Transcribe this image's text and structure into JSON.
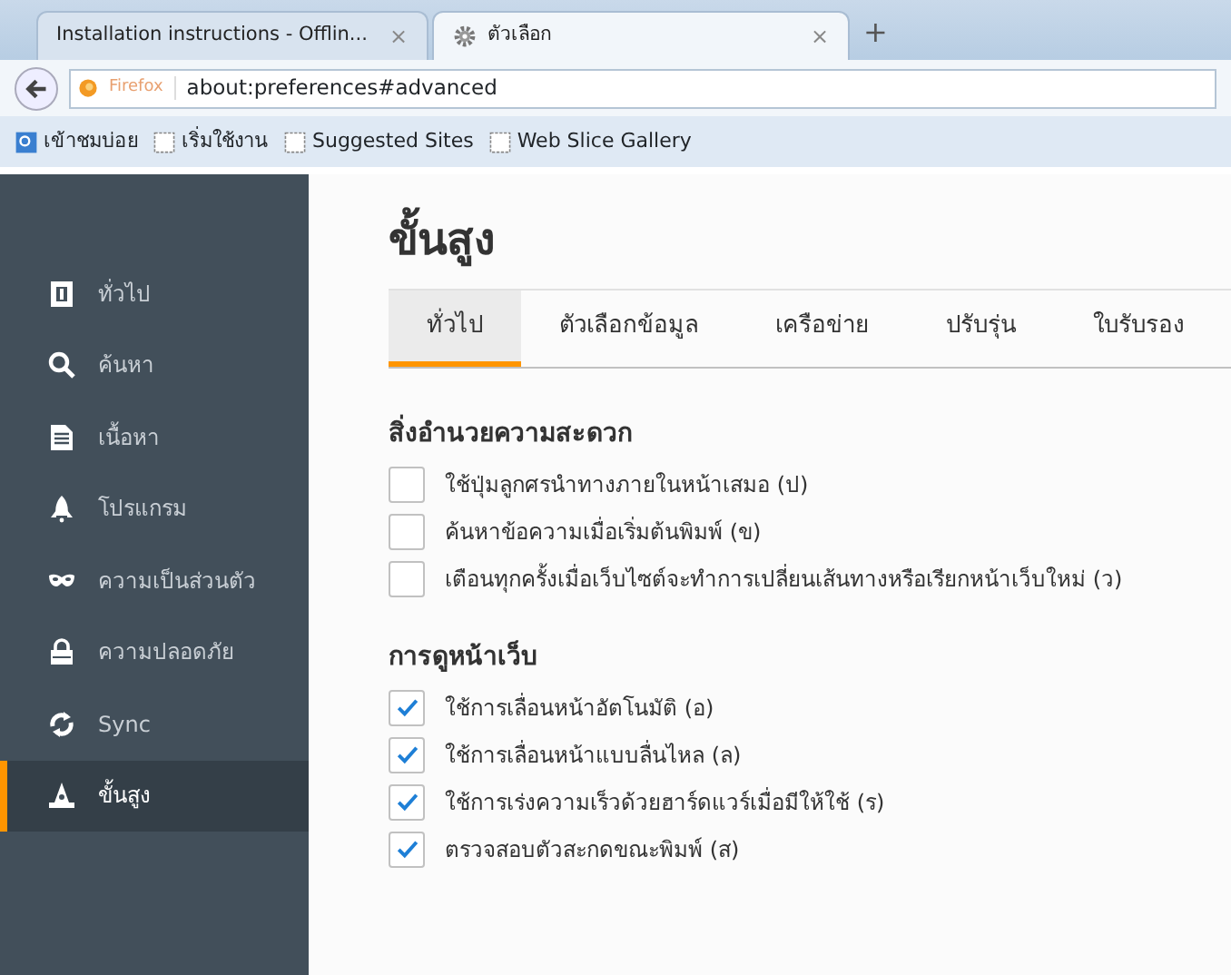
{
  "browser_tabs": [
    {
      "title": "Installation instructions - Offlin...",
      "close": "×",
      "selected": false,
      "kind": "plain"
    },
    {
      "title": "ตัวเลือก",
      "close": "×",
      "selected": true,
      "kind": "settings"
    }
  ],
  "new_tab": "+",
  "address_bar": {
    "identity": "Firefox",
    "url": "about:preferences#advanced"
  },
  "bookmarks": [
    {
      "label": "เข้าชมบ่อย",
      "kind": "folder"
    },
    {
      "label": "เริ่มใช้งาน",
      "kind": "page"
    },
    {
      "label": "Suggested Sites",
      "kind": "page"
    },
    {
      "label": "Web Slice Gallery",
      "kind": "page"
    }
  ],
  "sidebar": {
    "items": [
      {
        "label": "ทั่วไป",
        "selected": false
      },
      {
        "label": "ค้นหา",
        "selected": false
      },
      {
        "label": "เนื้อหา",
        "selected": false
      },
      {
        "label": "โปรแกรม",
        "selected": false
      },
      {
        "label": "ความเป็นส่วนตัว",
        "selected": false
      },
      {
        "label": "ความปลอดภัย",
        "selected": false
      },
      {
        "label": "Sync",
        "selected": false
      },
      {
        "label": "ขั้นสูง",
        "selected": true
      }
    ]
  },
  "heading": "ขั้นสูง",
  "tabs": [
    {
      "label": "ทั่วไป",
      "selected": true
    },
    {
      "label": "ตัวเลือกข้อมูล",
      "selected": false
    },
    {
      "label": "เครือข่าย",
      "selected": false
    },
    {
      "label": "ปรับรุ่น",
      "selected": false
    },
    {
      "label": "ใบรับรอง",
      "selected": false
    }
  ],
  "sections": [
    {
      "title": "สิ่งอำนวยความสะดวก",
      "options": [
        {
          "label": "ใช้ปุ่มลูกศรนำทางภายในหน้าเสมอ (ป)",
          "checked": false
        },
        {
          "label": "ค้นหาข้อความเมื่อเริ่มต้นพิมพ์ (ข)",
          "checked": false
        },
        {
          "label": "เตือนทุกครั้งเมื่อเว็บไซต์จะทำการเปลี่ยนเส้นทางหรือเรียกหน้าเว็บใหม่ (ว)",
          "checked": false
        }
      ]
    },
    {
      "title": "การดูหน้าเว็บ",
      "options": [
        {
          "label": "ใช้การเลื่อนหน้าอัตโนมัติ (อ)",
          "checked": true
        },
        {
          "label": "ใช้การเลื่อนหน้าแบบลื่นไหล (ล)",
          "checked": true
        },
        {
          "label": "ใช้การเร่งความเร็วด้วยฮาร์ดแวร์เมื่อมีให้ใช้ (ร)",
          "checked": true
        },
        {
          "label": "ตรวจสอบตัวสะกดขณะพิมพ์ (ส)",
          "checked": true
        }
      ]
    }
  ]
}
